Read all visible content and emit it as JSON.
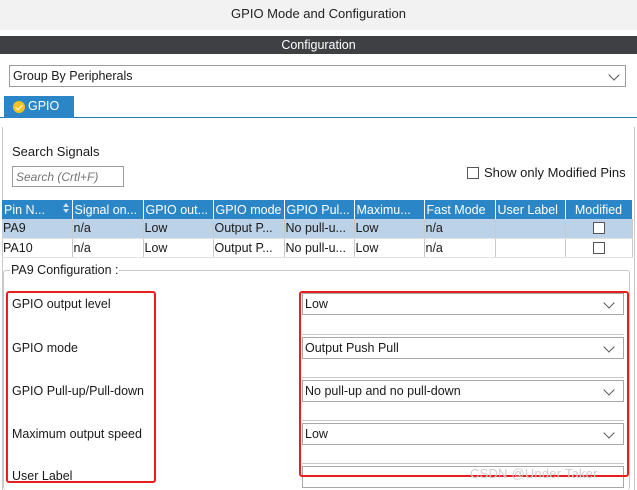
{
  "window": {
    "title": "GPIO Mode and Configuration"
  },
  "configuration": {
    "header": "Configuration"
  },
  "group_select": {
    "value": "Group By Peripherals"
  },
  "tabs": [
    {
      "label": "GPIO",
      "active": true
    }
  ],
  "search": {
    "label": "Search Signals",
    "placeholder": "Search (Crtl+F)"
  },
  "show_modified": {
    "label": "Show only Modified Pins",
    "checked": false
  },
  "table": {
    "columns": [
      "Pin N...",
      "Signal on...",
      "GPIO out...",
      "GPIO mode",
      "GPIO Pul...",
      "Maximu...",
      "Fast Mode",
      "User Label",
      "Modified"
    ],
    "rows": [
      {
        "pin": "PA9",
        "signal": "n/a",
        "output": "Low",
        "mode": "Output P...",
        "pull": "No pull-u...",
        "speed": "Low",
        "fast": "n/a",
        "user_label": "",
        "modified": false,
        "selected": true
      },
      {
        "pin": "PA10",
        "signal": "n/a",
        "output": "Low",
        "mode": "Output P...",
        "pull": "No pull-u...",
        "speed": "Low",
        "fast": "n/a",
        "user_label": "",
        "modified": false,
        "selected": false
      }
    ]
  },
  "pa9_config": {
    "legend": "PA9 Configuration :",
    "fields": [
      {
        "label": "GPIO output level",
        "value": "Low"
      },
      {
        "label": "GPIO mode",
        "value": "Output Push Pull"
      },
      {
        "label": "GPIO Pull-up/Pull-down",
        "value": "No pull-up and no pull-down"
      },
      {
        "label": "Maximum output speed",
        "value": "Low"
      },
      {
        "label": "User Label",
        "value": ""
      }
    ]
  },
  "watermark": "CSDN @Under Taker",
  "colors": {
    "header_dark": "#3e4044",
    "accent_blue": "#2a86c7",
    "selected_row": "#bcd2e8",
    "highlight_red": "#e81d1d",
    "tab_check": "#f3c321"
  }
}
